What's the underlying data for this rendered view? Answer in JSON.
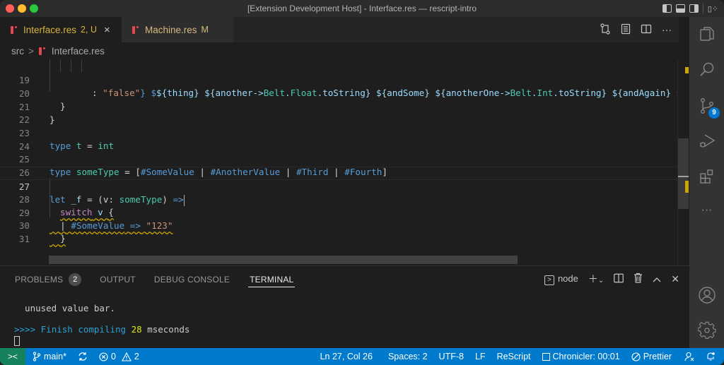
{
  "window": {
    "title": "[Extension Development Host] - Interface.res — rescript-intro"
  },
  "tabs": [
    {
      "name": "Interface.res",
      "status": "2, U",
      "active": true,
      "close": "×"
    },
    {
      "name": "Machine.res",
      "status": "M",
      "active": false
    }
  ],
  "breadcrumb": {
    "folder": "src",
    "separator": ">",
    "file": "Interface.res"
  },
  "editor": {
    "lines": [
      {
        "n": "19"
      },
      {
        "n": "20"
      },
      {
        "n": "21"
      },
      {
        "n": "22"
      },
      {
        "n": "23"
      },
      {
        "n": "24"
      },
      {
        "n": "25"
      },
      {
        "n": "26"
      },
      {
        "n": "27"
      },
      {
        "n": "28"
      },
      {
        "n": "29"
      },
      {
        "n": "30"
      },
      {
        "n": "31"
      }
    ],
    "tokens": {
      "l19_colon": ": ",
      "l19_false": "\"false\"",
      "l19_close": "}",
      "l19_i1": "${thing}",
      "l19_i2a": "${another->",
      "l19_i2b": "Belt",
      "l19_i2c": ".",
      "l19_i2d": "Float",
      "l19_i2e": ".toString}",
      "l19_i3": "${andSome}",
      "l19_i4a": "${anotherOne->",
      "l19_i4b": "Belt",
      "l19_i4c": ".",
      "l19_i4d": "Int",
      "l19_i4e": ".toString}",
      "l19_i5": "${andAgain}",
      "l19_i6": "${a",
      "l20": "}",
      "l21": "}",
      "l23_type": "type",
      "l23_t": "t",
      "l23_eq": "=",
      "l23_int": "int",
      "l25_type": "type",
      "l25_name": "someType",
      "l25_eq": "=",
      "l25_open": "[",
      "l25_v1": "#SomeValue",
      "l25_bar": "|",
      "l25_v2": "#AnotherValue",
      "l25_v3": "#Third",
      "l25_v4": "#Fourth",
      "l25_close": "]",
      "l27_let": "let",
      "l27_f": "_f",
      "l27_eq": "=",
      "l27_open": "(v: ",
      "l27_type": "someType",
      "l27_close": ")",
      "l27_arrow": "=>",
      "l28_switch": "switch",
      "l28_v": "v",
      "l28_brace": "{",
      "l29_bar": "|",
      "l29_val": "#SomeValue",
      "l29_arrow": "=>",
      "l29_str": "\"123\"",
      "l30": "}"
    }
  },
  "panel": {
    "tabs": [
      {
        "label": "PROBLEMS",
        "badge": "2"
      },
      {
        "label": "OUTPUT"
      },
      {
        "label": "DEBUG CONSOLE"
      },
      {
        "label": "TERMINAL",
        "active": true
      }
    ],
    "terminal_name": "node",
    "terminal_lines": {
      "line1": "  unused value bar.",
      "prompt": ">>>>",
      "compile_text": "Finish compiling",
      "ms": "28",
      "unit": "mseconds"
    }
  },
  "activity_bar": {
    "source_control_badge": "9"
  },
  "status_bar": {
    "branch": "main*",
    "errors": "0",
    "warnings": "2",
    "position": "Ln 27, Col 26",
    "spaces": "Spaces: 2",
    "encoding": "UTF-8",
    "eol": "LF",
    "language": "ReScript",
    "chronicler": "Chronicler: 00:01",
    "prettier": "Prettier"
  },
  "colors": {
    "status_bar": "#007acc",
    "remote": "#16825d",
    "warning": "#cca700",
    "badge": "#0078d4"
  }
}
